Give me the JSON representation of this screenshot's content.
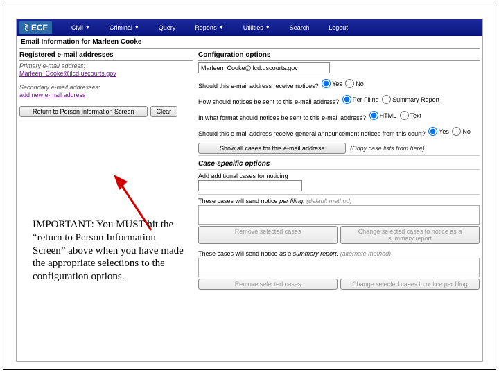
{
  "nav": {
    "logo": "ECF",
    "items": [
      "Civil",
      "Criminal",
      "Query",
      "Reports",
      "Utilities",
      "Search",
      "Logout"
    ],
    "dropdowns": [
      true,
      true,
      false,
      true,
      true,
      false,
      false
    ]
  },
  "page_title": "Email Information for Marleen Cooke",
  "left": {
    "registered_head": "Registered e-mail addresses",
    "primary_label": "Primary e-mail address:",
    "primary_email": "Marleen_Cooke@ilcd.uscourts.gov",
    "secondary_label": "Secondary e-mail addresses:",
    "add_new": "add new e-mail address",
    "return_btn": "Return to Person Information Screen",
    "clear_btn": "Clear"
  },
  "right": {
    "config_head": "Configuration options",
    "email_value": "Marleen_Cooke@ilcd.uscourts.gov",
    "q1": "Should this e-mail address receive notices?",
    "q2": "How should notices be sent to this e-mail address?",
    "q3": "In what format should notices be sent to this e-mail address?",
    "q4": "Should this e-mail address receive general announcement notices from this court?",
    "yes": "Yes",
    "no": "No",
    "per_filing": "Per Filing",
    "summary_report": "Summary Report",
    "html": "HTML",
    "text": "Text",
    "show_all_btn": "Show all cases for this e-mail address",
    "copy_hint": "(Copy case lists from here)",
    "case_head": "Case-specific options",
    "add_cases_label": "Add additional cases for noticing",
    "line1_a": "These cases will send notice ",
    "line1_b": "per filing.",
    "line1_c": " (default method)",
    "remove_btn": "Remove selected cases",
    "change_summary_btn": "Change selected cases to notice as a summary report",
    "line2_a": "These cases will send notice ",
    "line2_b": "as a summary report.",
    "line2_c": " (alternate method)",
    "change_per_filing_btn": "Change selected cases to notice per filing"
  },
  "annotation": "IMPORTANT:   You MUST hit the “return to Person Information Screen” above when you have made the appropriate selections to the configuration options."
}
